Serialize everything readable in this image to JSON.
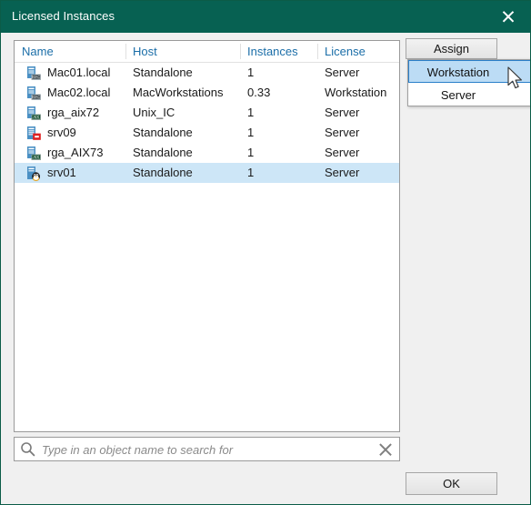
{
  "window": {
    "title": "Licensed Instances",
    "close_icon": "close-icon",
    "titlebar_color": "#076152",
    "background_color": "#f0f0f0"
  },
  "list": {
    "columns": [
      {
        "label": "Name"
      },
      {
        "label": "Host"
      },
      {
        "label": "Instances"
      },
      {
        "label": "License"
      }
    ],
    "header_color": "#1b6ea8",
    "selection_color": "#cde6f7",
    "rows": [
      {
        "icon": "mac-server-icon",
        "name": "Mac01.local",
        "host": "Standalone",
        "instances": "1",
        "license": "Server",
        "selected": false
      },
      {
        "icon": "mac-server-icon",
        "name": "Mac02.local",
        "host": "MacWorkstations",
        "instances": "0.33",
        "license": "Workstation",
        "selected": false
      },
      {
        "icon": "aix-server-icon",
        "name": "rga_aix72",
        "host": "Unix_IC",
        "instances": "1",
        "license": "Server",
        "selected": false
      },
      {
        "icon": "server-error-icon",
        "name": "srv09",
        "host": "Standalone",
        "instances": "1",
        "license": "Server",
        "selected": false
      },
      {
        "icon": "aix-server-icon",
        "name": "rga_AIX73",
        "host": "Standalone",
        "instances": "1",
        "license": "Server",
        "selected": false
      },
      {
        "icon": "linux-server-icon",
        "name": "srv01",
        "host": "Standalone",
        "instances": "1",
        "license": "Server",
        "selected": true
      }
    ]
  },
  "search": {
    "icon": "search-icon",
    "placeholder": "Type in an object name to search for",
    "value": "",
    "clear_icon": "clear-icon"
  },
  "actions": {
    "assign_label": "Assign",
    "ok_label": "OK"
  },
  "assign_menu": {
    "items": [
      {
        "label": "Workstation",
        "highlighted": true
      },
      {
        "label": "Server",
        "highlighted": false
      }
    ],
    "highlight_color": "#bcdcf5",
    "highlight_border": "#2a7fc9"
  }
}
